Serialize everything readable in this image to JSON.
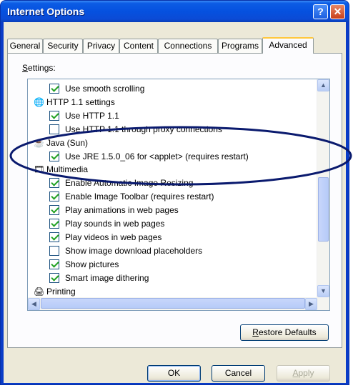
{
  "window": {
    "title": "Internet Options",
    "help_glyph": "?",
    "close_glyph": "✕"
  },
  "tabs": [
    {
      "label": "General",
      "active": false
    },
    {
      "label": "Security",
      "active": false
    },
    {
      "label": "Privacy",
      "active": false
    },
    {
      "label": "Content",
      "active": false
    },
    {
      "label": "Connections",
      "active": false
    },
    {
      "label": "Programs",
      "active": false
    },
    {
      "label": "Advanced",
      "active": true
    }
  ],
  "settings": {
    "label_mnemonic": "S",
    "label_rest": "ettings:",
    "items": [
      {
        "kind": "check",
        "checked": true,
        "label": "Use smooth scrolling"
      },
      {
        "kind": "group",
        "icon": "globe-page-icon",
        "label": "HTTP 1.1 settings"
      },
      {
        "kind": "check",
        "checked": true,
        "label": "Use HTTP 1.1"
      },
      {
        "kind": "check",
        "checked": false,
        "label": "Use HTTP 1.1 through proxy connections"
      },
      {
        "kind": "group",
        "icon": "java-cup-icon",
        "label": "Java (Sun)"
      },
      {
        "kind": "check",
        "checked": true,
        "label": "Use JRE 1.5.0_06 for <applet> (requires restart)"
      },
      {
        "kind": "group",
        "icon": "multimedia-icon",
        "label": "Multimedia"
      },
      {
        "kind": "check",
        "checked": true,
        "label": "Enable Automatic Image Resizing"
      },
      {
        "kind": "check",
        "checked": true,
        "label": "Enable Image Toolbar (requires restart)"
      },
      {
        "kind": "check",
        "checked": true,
        "label": "Play animations in web pages"
      },
      {
        "kind": "check",
        "checked": true,
        "label": "Play sounds in web pages"
      },
      {
        "kind": "check",
        "checked": true,
        "label": "Play videos in web pages"
      },
      {
        "kind": "check",
        "checked": false,
        "label": "Show image download placeholders"
      },
      {
        "kind": "check",
        "checked": true,
        "label": "Show pictures"
      },
      {
        "kind": "check",
        "checked": true,
        "label": "Smart image dithering"
      },
      {
        "kind": "group",
        "icon": "printer-icon",
        "label": "Printing"
      }
    ]
  },
  "restore": {
    "mnemonic": "R",
    "rest": "estore Defaults"
  },
  "footer": {
    "ok": "OK",
    "cancel": "Cancel",
    "apply_mnemonic": "A",
    "apply_rest": "pply"
  },
  "colors": {
    "annotation": "#0a1a6e",
    "titlebar": "#0554e0",
    "check": "#21a121"
  }
}
